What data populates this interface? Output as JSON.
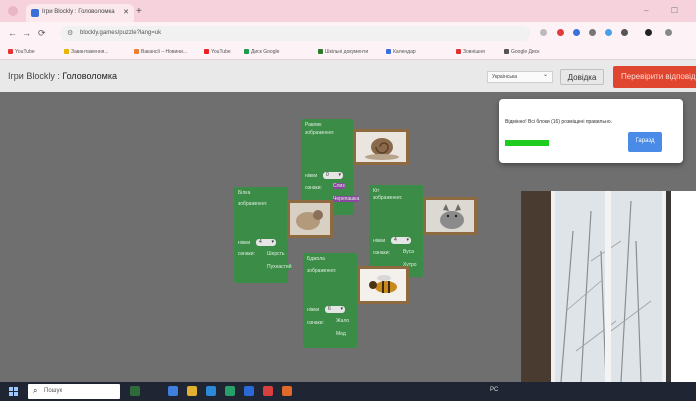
{
  "browser": {
    "tab_title": "Ігри Blockly : Головоломка",
    "url": "blockly.games/puzzle?lang=uk",
    "bookmarks": [
      "YouTube",
      "Завантаження...",
      "Вакансії – Новини...",
      "YouTube",
      "Диск Google",
      "Шкільні документи",
      "Календар",
      "Зовнішня",
      "Google Диск"
    ],
    "colors": {
      "tabbar": "#f6d3dc"
    }
  },
  "header": {
    "title_prefix": "Ігри Blockly",
    "title_sep": " : ",
    "title_game": "Головоломка",
    "language": "Українська",
    "help_button": "Довідка",
    "check_button": "Перевірити відповідь"
  },
  "blocks": [
    {
      "id": "snail",
      "name": "Равлик",
      "picture_label": "зображення:",
      "legs_label": "ніжки",
      "legs_value": "0",
      "traits_label": "ознаки:",
      "traits": [
        "Слиз",
        "Черепашка"
      ],
      "icon": "snail-icon"
    },
    {
      "id": "dog",
      "name": "Білка",
      "picture_label": "зображення:",
      "legs_label": "ніжки",
      "legs_value": "4",
      "traits_label": "ознаки:",
      "traits": [
        "Шерсть",
        "Пухнастий"
      ],
      "icon": "animal-icon"
    },
    {
      "id": "cat",
      "name": "Кіт",
      "picture_label": "зображення:",
      "legs_label": "ніжки",
      "legs_value": "4",
      "traits_label": "ознаки:",
      "traits": [
        "Вуса",
        "Хутро"
      ],
      "icon": "cat-icon"
    },
    {
      "id": "bee",
      "name": "Бджола",
      "picture_label": "зображення:",
      "legs_label": "ніжки",
      "legs_value": "6",
      "traits_label": "ознаки:",
      "traits": [
        "Жало",
        "Мед"
      ],
      "icon": "bee-icon"
    }
  ],
  "dialog": {
    "message": "Відмінно! Всі блоки (16) розміщені правильно.",
    "ok_button": "Гаразд",
    "progress": 1.0,
    "progress_color": "#1fcc1f"
  },
  "taskbar": {
    "search_placeholder": "Пошук",
    "tray": "PC"
  },
  "colors": {
    "block": "#3a8c46",
    "chip": "#8a47a0",
    "check_button": "#e0452f",
    "ok_button": "#4a8be8",
    "workspace": "#6f6f6f"
  }
}
